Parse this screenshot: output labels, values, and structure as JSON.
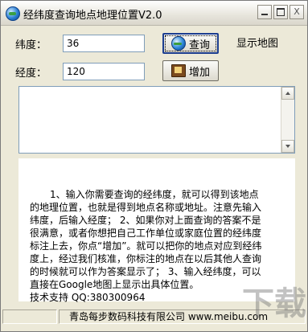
{
  "window": {
    "title": "经纬度查询地点地理位置V2.0",
    "close_label": "X"
  },
  "form": {
    "lat_label": "纬度：",
    "lat_value": "36",
    "lng_label": "经度：",
    "lng_value": "120",
    "query_label": "查询",
    "add_label": "增加",
    "show_map_label": "显示地图"
  },
  "help": {
    "text": "1、输入你需要查询的经纬度，就可以得到该地点的地理位置，也就是得到地点名称或地址。注意先输入纬度，后输入经度； 2、如果你对上面查询的答案不是很满意，或者你想把自己工作单位或家庭位置的经纬度标注上去，你点“增加”。就可以把你的地点对应到经纬度上，经过我们核准，你标注的地点在以后其他人查询的时候就可以作为答案显示了； 3、输入经纬度，可以直接在Google地图上显示出具体位置。",
    "support": "技术支持 QQ:380300964"
  },
  "status": {
    "company": "青岛每步数码科技有限公司 www.meibu.com"
  },
  "watermark": {
    "text": "下载"
  }
}
